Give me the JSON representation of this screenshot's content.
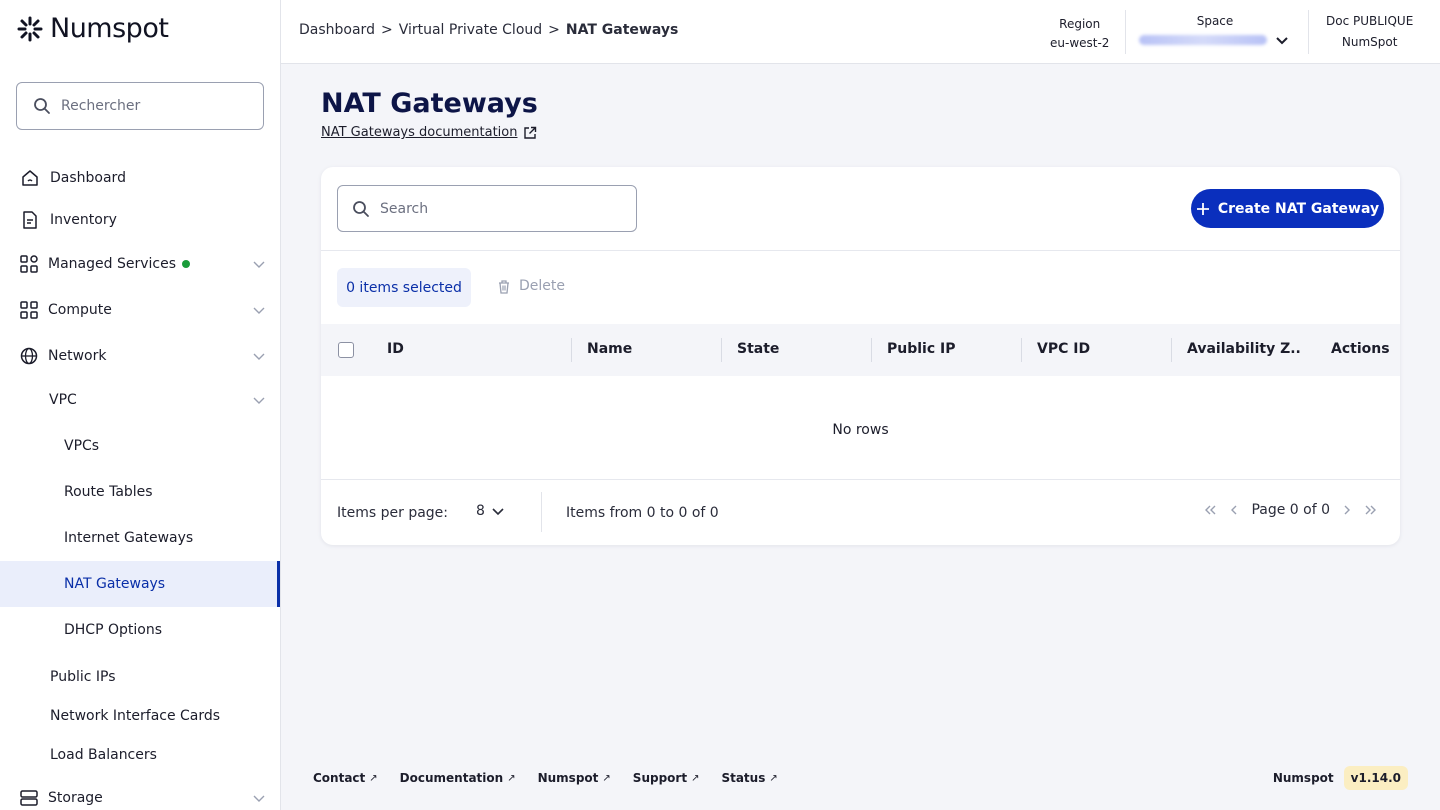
{
  "app": {
    "brand": "Numspot"
  },
  "sidebar": {
    "search_placeholder": "Rechercher",
    "items": [
      {
        "label": "Dashboard",
        "icon": "home-icon"
      },
      {
        "label": "Inventory",
        "icon": "document-icon"
      },
      {
        "label": "Managed Services",
        "icon": "apps-icon"
      },
      {
        "label": "Compute",
        "icon": "grid-icon"
      },
      {
        "label": "Network",
        "icon": "globe-icon"
      },
      {
        "label": "VPC"
      },
      {
        "label": "VPCs"
      },
      {
        "label": "Route Tables"
      },
      {
        "label": "Internet Gateways"
      },
      {
        "label": "NAT Gateways"
      },
      {
        "label": "DHCP Options"
      },
      {
        "label": "Public IPs"
      },
      {
        "label": "Network Interface Cards"
      },
      {
        "label": "Load Balancers"
      },
      {
        "label": "Storage",
        "icon": "storage-icon"
      }
    ],
    "active_item": "NAT Gateways"
  },
  "header": {
    "breadcrumb": [
      "Dashboard",
      "Virtual Private Cloud",
      "NAT Gateways"
    ],
    "breadcrumb_sep": ">",
    "region_label": "Region",
    "region_value": "eu-west-2",
    "space_label": "Space",
    "org_label": "Doc PUBLIQUE",
    "org_value": "NumSpot"
  },
  "main": {
    "title": "NAT Gateways",
    "doc_link": "NAT Gateways documentation",
    "search_placeholder": "Search",
    "create_button": "Create NAT Gateway",
    "selected_text": "0 items selected",
    "delete_label": "Delete",
    "columns": [
      "ID",
      "Name",
      "State",
      "Public IP",
      "VPC ID",
      "Availability Z..",
      "Actions"
    ],
    "empty_text": "No rows",
    "per_page_label": "Items per page:",
    "per_page_value": "8",
    "range_text": "Items from 0 to 0 of 0",
    "page_text": "Page 0 of 0"
  },
  "footer": {
    "links": [
      "Contact",
      "Documentation",
      "Numspot",
      "Support",
      "Status"
    ],
    "brand": "Numspot",
    "version": "v1.14.0"
  },
  "colors": {
    "primary": "#0a2fbd",
    "active_text": "#0a2fa8",
    "status_green": "#1a9c3a",
    "version_bg": "#fbeec2"
  }
}
